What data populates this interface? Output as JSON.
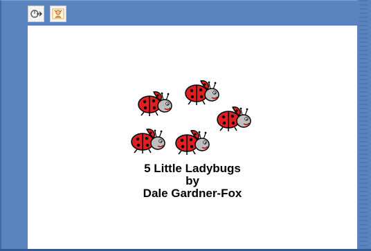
{
  "toolbar": {
    "buttons": [
      {
        "name": "back-button",
        "icon": "arrow-back-icon"
      },
      {
        "name": "menu-button",
        "icon": "character-icon"
      }
    ]
  },
  "title": {
    "line1": "5 Little Ladybugs",
    "line2": "by",
    "line3": "Dale Gardner-Fox"
  },
  "colors": {
    "frame": "#5a84bd",
    "bug_red": "#e02020",
    "bug_black": "#111111",
    "bug_head": "#bfbfbf"
  },
  "illustration": {
    "ladybug_count": 5
  }
}
